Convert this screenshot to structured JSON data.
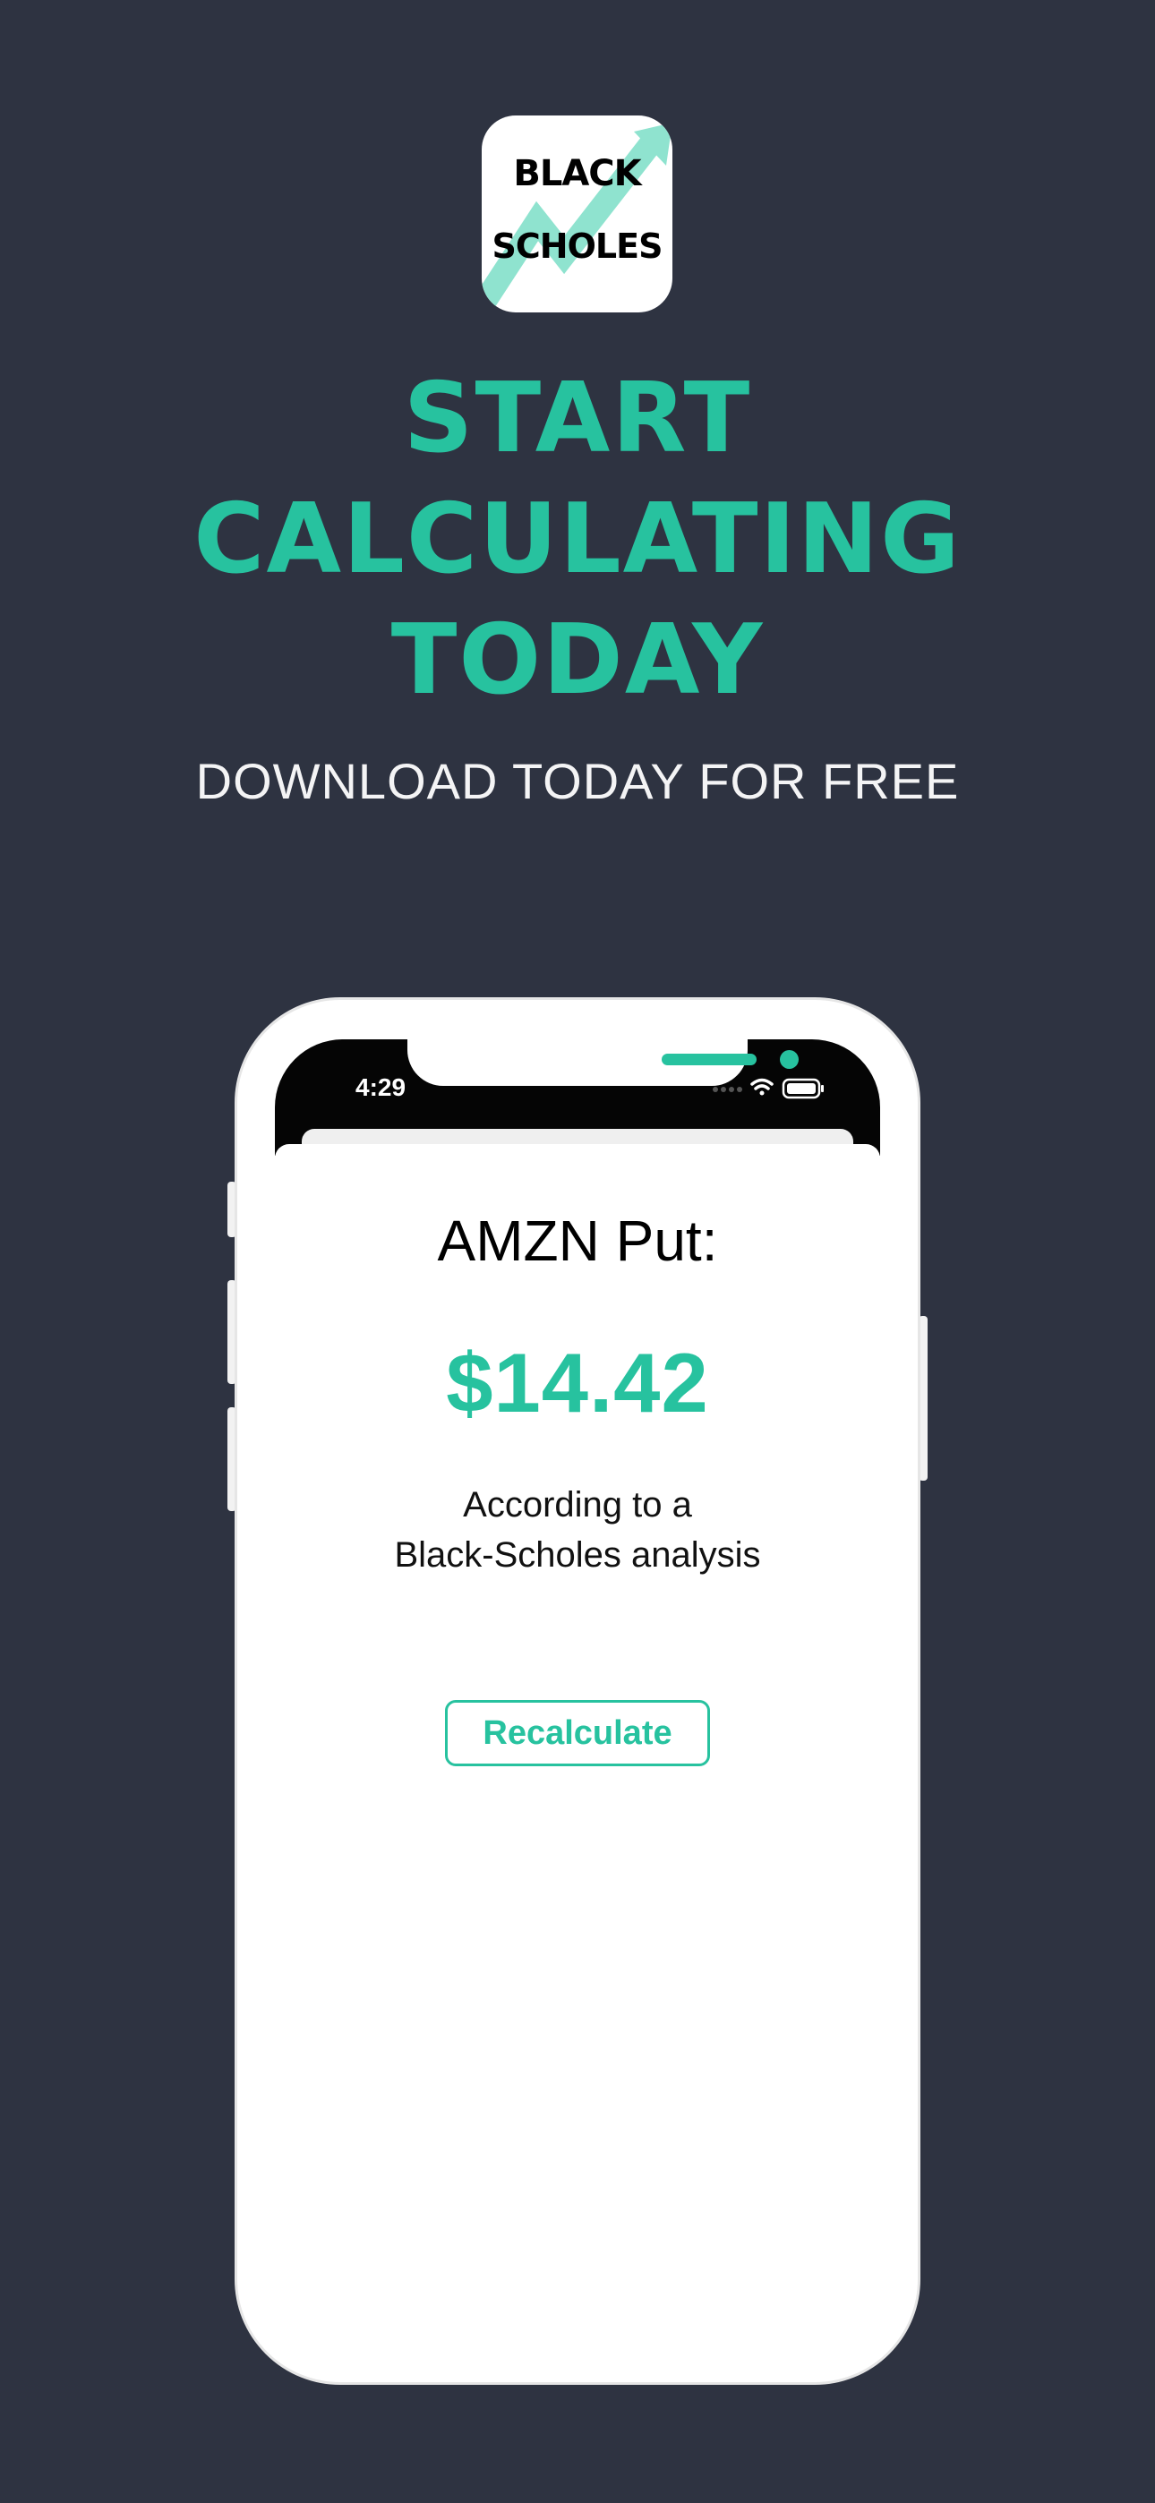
{
  "brand": {
    "icon_line1": "BLACK",
    "icon_line2": "SCHOLES",
    "accent_color": "#27c29f",
    "background_color": "#2e3341"
  },
  "headline": {
    "line1": "START",
    "line2": "CALCULATING",
    "line3": "TODAY"
  },
  "subheadline": "DOWNLOAD TODAY FOR FREE",
  "phone": {
    "status_time": "4:29",
    "status_icons": [
      "signal-icon",
      "wifi-icon",
      "battery-icon"
    ],
    "card": {
      "title": "AMZN Put:",
      "price": "$14.42",
      "description_line1": "According to a",
      "description_line2": "Black-Scholes analysis",
      "recalculate_label": "Recalculate"
    }
  }
}
